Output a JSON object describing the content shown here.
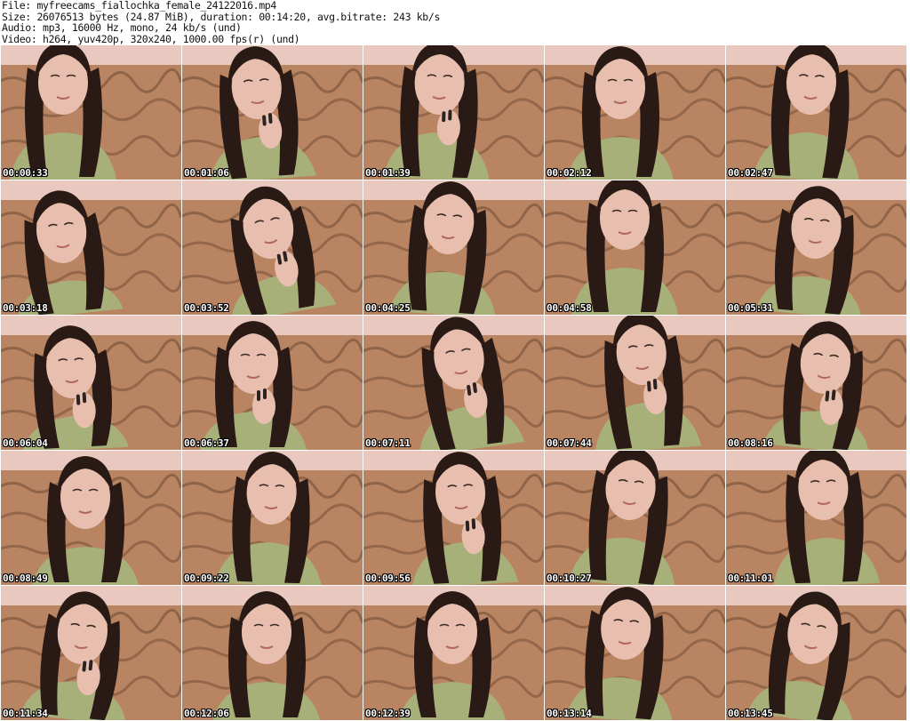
{
  "header": {
    "file_line": "File: myfreecams_fiallochka_female_24122016.mp4",
    "size_line": "Size: 26076513 bytes (24.87 MiB), duration: 00:14:20, avg.bitrate: 243 kb/s",
    "audio_line": "Audio: mp3, 16000 Hz, mono, 24 kb/s (und)",
    "video_line": "Video: h264, yuv420p, 320x240, 1000.00 fps(r) (und)"
  },
  "thumbnails": [
    {
      "timestamp": "00:00:33"
    },
    {
      "timestamp": "00:01:06"
    },
    {
      "timestamp": "00:01:39"
    },
    {
      "timestamp": "00:02:12"
    },
    {
      "timestamp": "00:02:47"
    },
    {
      "timestamp": "00:03:18"
    },
    {
      "timestamp": "00:03:52"
    },
    {
      "timestamp": "00:04:25"
    },
    {
      "timestamp": "00:04:58"
    },
    {
      "timestamp": "00:05:31"
    },
    {
      "timestamp": "00:06:04"
    },
    {
      "timestamp": "00:06:37"
    },
    {
      "timestamp": "00:07:11"
    },
    {
      "timestamp": "00:07:44"
    },
    {
      "timestamp": "00:08:16"
    },
    {
      "timestamp": "00:08:49"
    },
    {
      "timestamp": "00:09:22"
    },
    {
      "timestamp": "00:09:56"
    },
    {
      "timestamp": "00:10:27"
    },
    {
      "timestamp": "00:11:01"
    },
    {
      "timestamp": "00:11:34"
    },
    {
      "timestamp": "00:12:06"
    },
    {
      "timestamp": "00:12:39"
    },
    {
      "timestamp": "00:13:14"
    },
    {
      "timestamp": "00:13:45"
    }
  ],
  "colors": {
    "wall": "#e9c8c0",
    "sofa": "#b98462",
    "sofa_pattern": "#6f4a33",
    "hair": "#2a1a16",
    "skin": "#e8bfae",
    "sweater": "#a8b07a",
    "timestamp_text": "#ffffff"
  }
}
